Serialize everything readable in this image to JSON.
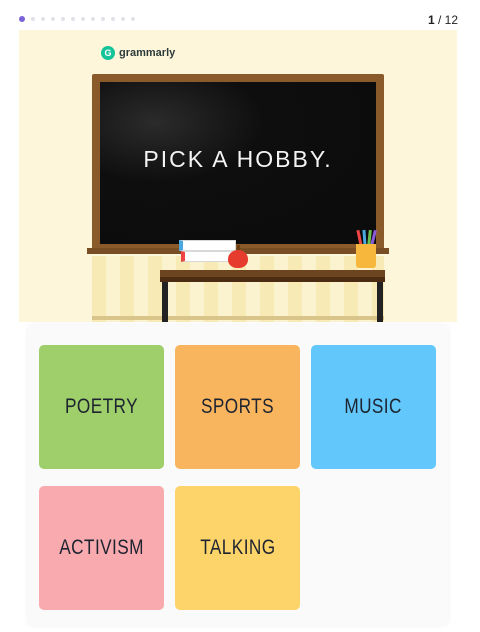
{
  "progress": {
    "current": "1",
    "separator": " / ",
    "total": "12",
    "dot_count": 12,
    "active_index": 0
  },
  "hero": {
    "logo_letter": "G",
    "logo_text": "grammarly",
    "board_text": "PICK A HOBBY."
  },
  "options": [
    {
      "label": "POETRY",
      "color": "#9fcf6b"
    },
    {
      "label": "SPORTS",
      "color": "#f9b55e"
    },
    {
      "label": "MUSIC",
      "color": "#62c7fb"
    },
    {
      "label": "ACTIVISM",
      "color": "#f9aaaf"
    },
    {
      "label": "TALKING",
      "color": "#fdd46a"
    }
  ],
  "colors": {
    "accent": "#7b62d6",
    "logo_green": "#15c39a",
    "hero_bg": "#fdf6db",
    "board_frame": "#8b5a2b"
  }
}
